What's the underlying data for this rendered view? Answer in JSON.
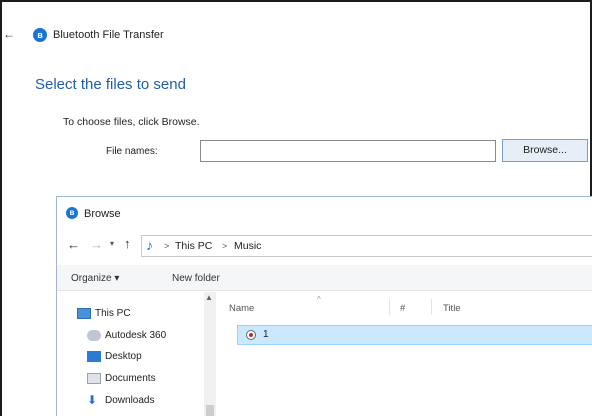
{
  "window": {
    "title": "Bluetooth File Transfer",
    "back_glyph": "←"
  },
  "main": {
    "heading": "Select the files to send",
    "instruction": "To choose files, click Browse.",
    "file_names_label": "File names:",
    "file_names_value": "",
    "browse_button": "Browse..."
  },
  "browse_dialog": {
    "title": "Browse",
    "nav": {
      "back": "←",
      "forward": "→",
      "recent": "▾",
      "up": "↑"
    },
    "address": {
      "icon": "music-note-icon",
      "crumbs": [
        "This PC",
        "Music"
      ],
      "separator": ">"
    },
    "toolbar": {
      "organize": "Organize ▾",
      "new_folder": "New folder"
    },
    "nav_pane": [
      {
        "label": "This PC",
        "icon": "computer-icon"
      },
      {
        "label": "Autodesk 360",
        "icon": "cloud-icon"
      },
      {
        "label": "Desktop",
        "icon": "desktop-icon"
      },
      {
        "label": "Documents",
        "icon": "documents-icon"
      },
      {
        "label": "Downloads",
        "icon": "downloads-icon"
      }
    ],
    "columns": {
      "name": "Name",
      "number": "#",
      "title": "Title"
    },
    "files": [
      {
        "name": "1",
        "icon": "audio-file-icon",
        "selected": true
      }
    ]
  },
  "colors": {
    "accent": "#1f5fa8",
    "selection": "#cce8ff",
    "bluetooth": "#1a73d6"
  }
}
